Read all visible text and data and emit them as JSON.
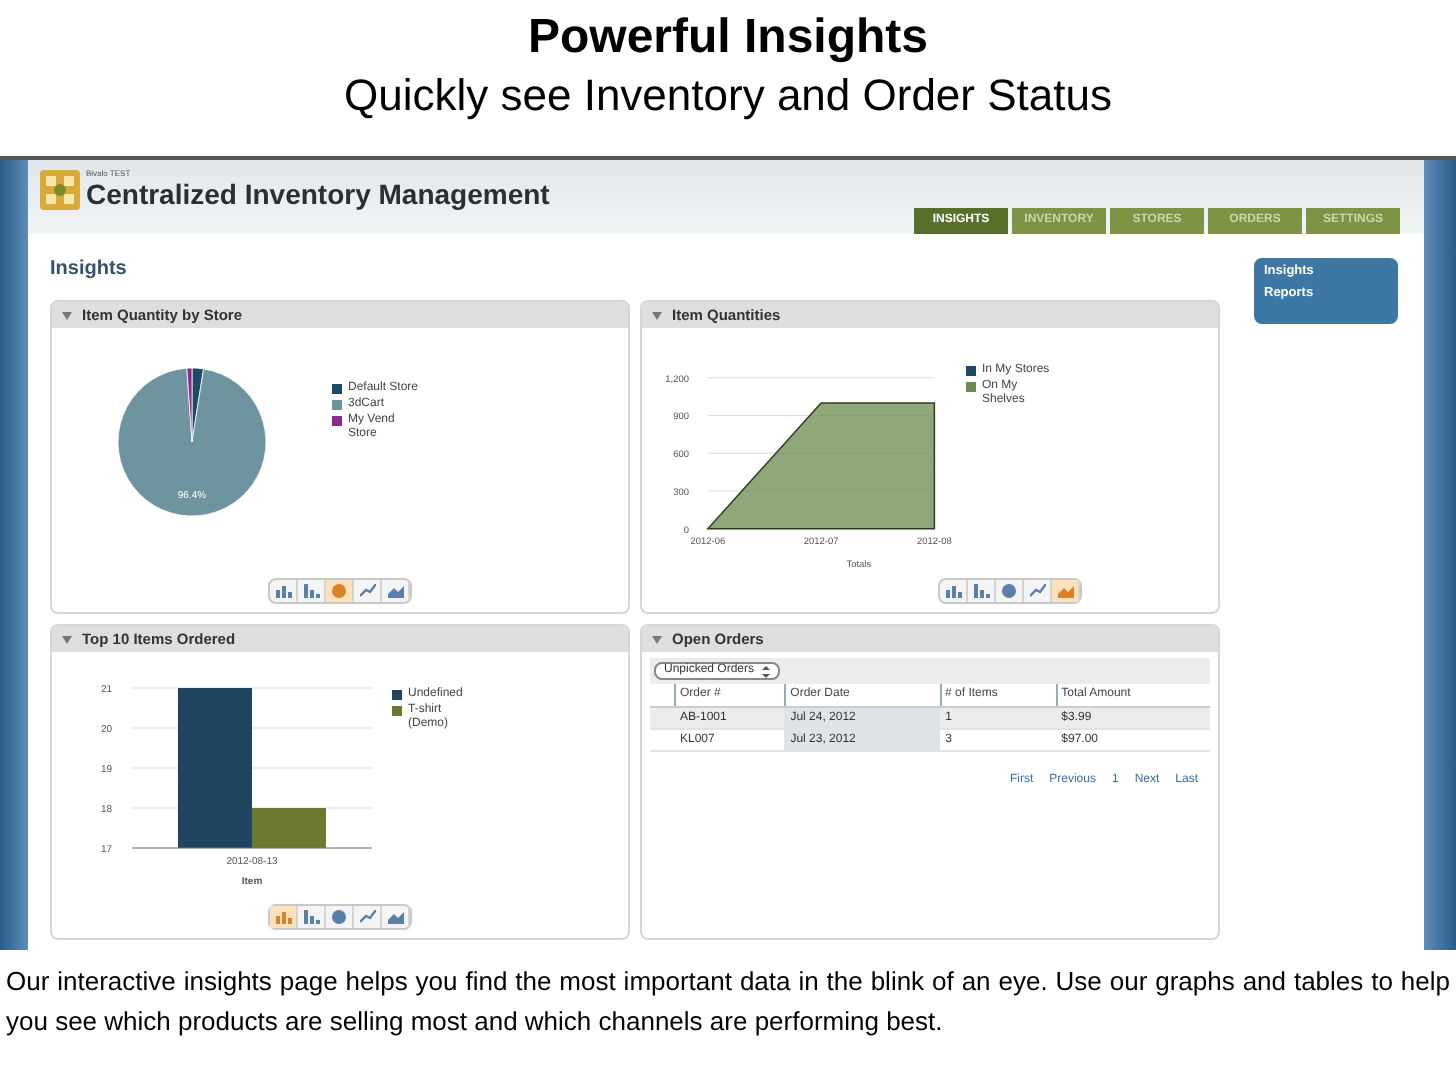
{
  "slide": {
    "title": "Powerful Insights",
    "subtitle": "Quickly see Inventory and Order Status",
    "caption": "Our interactive insights page helps you find the most important data in the blink of an eye. Use our graphs and tables to help you see which products are selling most and which channels are performing best."
  },
  "app": {
    "account": "Bivalo TEST",
    "title": "Centralized Inventory Management",
    "page_title": "Insights",
    "tabs": [
      {
        "label": "INSIGHTS",
        "selected": true
      },
      {
        "label": "INVENTORY",
        "selected": false
      },
      {
        "label": "STORES",
        "selected": false
      },
      {
        "label": "ORDERS",
        "selected": false
      },
      {
        "label": "SETTINGS",
        "selected": false
      }
    ],
    "sidebar": {
      "items": [
        {
          "label": "Insights"
        },
        {
          "label": "Reports"
        }
      ]
    }
  },
  "panels": [
    {
      "kind": "pie",
      "title": "Item Quantity by Store",
      "legend": [
        {
          "label": "Default Store",
          "color": "#1f4a66"
        },
        {
          "label": "3dCart",
          "color": "#6e959f"
        },
        {
          "label": "My Vend Store",
          "color": "#8a2a8a"
        }
      ],
      "slice_label": "96.4%",
      "chart_buttons": [
        {
          "selected": false
        },
        {
          "selected": false
        },
        {
          "selected": true
        },
        {
          "selected": false
        },
        {
          "selected": false
        }
      ]
    },
    {
      "kind": "area",
      "title": "Item Quantities",
      "chart_data": {
        "type": "area",
        "xlabel": "Totals",
        "categories": [
          "2012-06",
          "2012-07",
          "2012-08"
        ],
        "series": [
          {
            "name": "In My Stores",
            "color": "#1f4a66",
            "values": [
              null,
              null,
              null
            ]
          },
          {
            "name": "On My Shelves",
            "color": "#6b8a4e",
            "values": [
              0,
              1000,
              1000
            ]
          }
        ],
        "grid": true,
        "ylim": [
          0,
          1200
        ],
        "yticks": [
          0,
          300,
          600,
          900,
          {
            "value": 1200,
            "label": "1,200"
          }
        ]
      },
      "chart_buttons": [
        {
          "selected": false
        },
        {
          "selected": false
        },
        {
          "selected": false
        },
        {
          "selected": false
        },
        {
          "selected": true
        }
      ]
    },
    {
      "kind": "bar",
      "title": "Top 10 Items Ordered",
      "chart_data": {
        "type": "bar",
        "xlabel": "Item",
        "categories": [
          "2012-08-13"
        ],
        "series": [
          {
            "name": "Undefined",
            "color": "#1f4560",
            "values": [
              21
            ]
          },
          {
            "name": "T-shirt (Demo)",
            "color": "#6b7a2e",
            "values": [
              18
            ]
          }
        ],
        "grid": true,
        "ylim": [
          17,
          21
        ],
        "yticks": [
          17,
          18,
          19,
          20,
          21
        ]
      },
      "chart_buttons": [
        {
          "selected": true
        },
        {
          "selected": false
        },
        {
          "selected": false
        },
        {
          "selected": false
        },
        {
          "selected": false
        }
      ]
    },
    {
      "kind": "table",
      "title": "Open Orders",
      "filter": "Unpicked Orders",
      "columns": [
        "Order #",
        "Order Date",
        "# of Items",
        "Total Amount"
      ],
      "rows": [
        [
          "AB-1001",
          "Jul 24, 2012",
          "1",
          "$3.99"
        ],
        [
          "KL007",
          "Jul 23, 2012",
          "3",
          "$97.00"
        ]
      ],
      "pager": [
        "First",
        "Previous",
        "1",
        "Next",
        "Last"
      ]
    }
  ]
}
